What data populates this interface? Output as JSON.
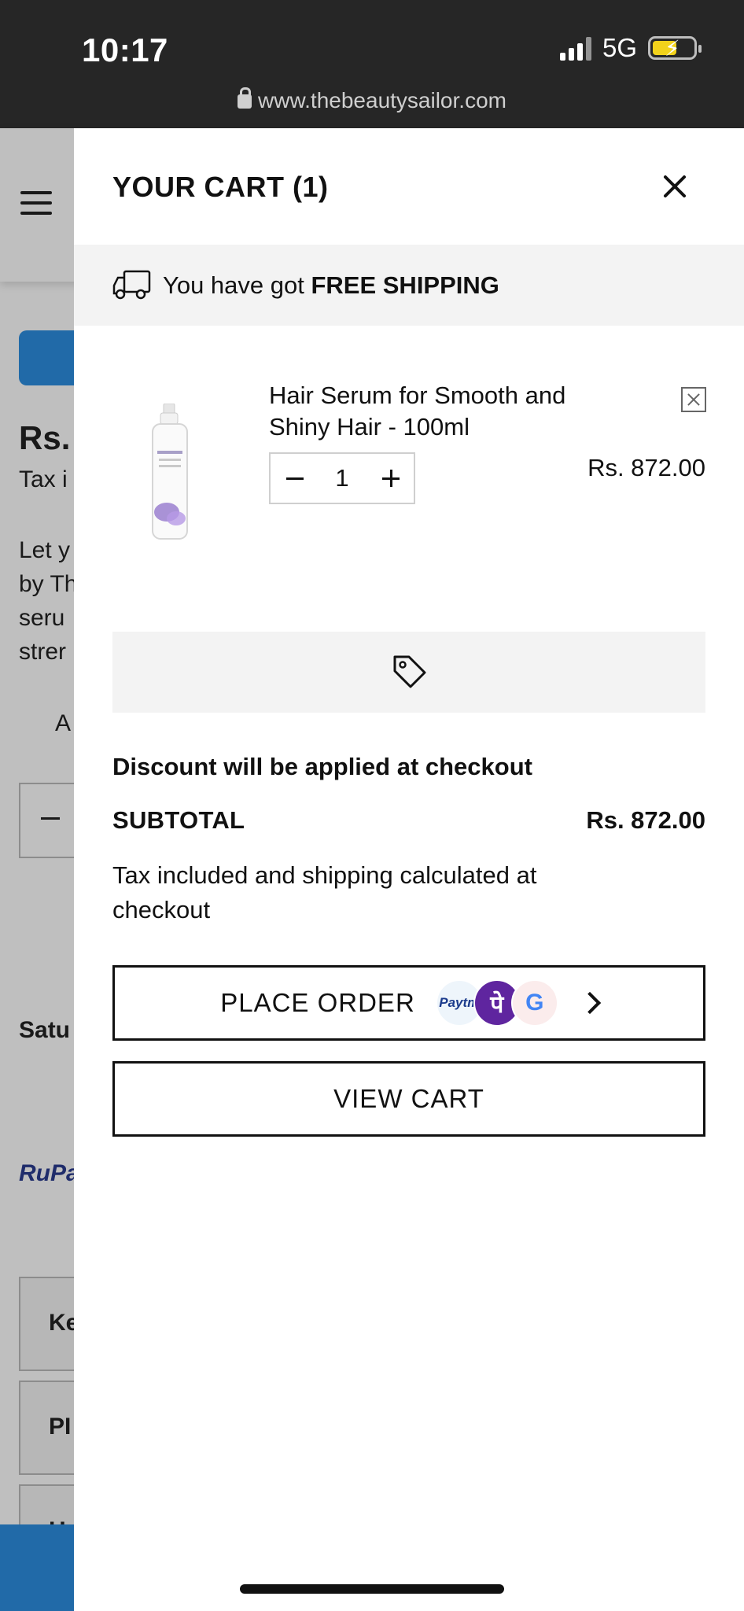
{
  "status_bar": {
    "time": "10:17",
    "network": "5G",
    "url": "www.thebeautysailor.com"
  },
  "background_page": {
    "price_fragment": "Rs.",
    "tax_fragment": "Tax i",
    "desc_lines": [
      "Let y",
      "by Th",
      "seru",
      "strer"
    ],
    "wishlist_fragment": "A",
    "delivery_fragment": "Satu",
    "rupay_fragment": "RuPa",
    "accordion_fragments": [
      "Ke",
      "PI",
      "H"
    ]
  },
  "cart": {
    "title": "YOUR CART (1)",
    "shipping_prefix": "You have got ",
    "shipping_bold": "FREE SHIPPING",
    "items": [
      {
        "name": "Hair Serum for Smooth and Shiny Hair - 100ml",
        "quantity": "1",
        "price": "Rs. 872.00"
      }
    ],
    "discount_note": "Discount will be applied at checkout",
    "subtotal_label": "SUBTOTAL",
    "subtotal_value": "Rs. 872.00",
    "tax_note": "Tax included and shipping calculated at checkout",
    "place_order_label": "PLACE ORDER",
    "view_cart_label": "VIEW CART",
    "payment_icons": [
      "paytm",
      "phonepe",
      "google-pay"
    ],
    "payment_text": {
      "paytm": "Paytm",
      "phonepe": "पे",
      "gpay": "G"
    }
  },
  "colors": {
    "status_bar_bg": "#262626",
    "accent_blue": "#2d8ee0",
    "panel_gray": "#f3f3f3",
    "battery": "#f2d21b"
  }
}
